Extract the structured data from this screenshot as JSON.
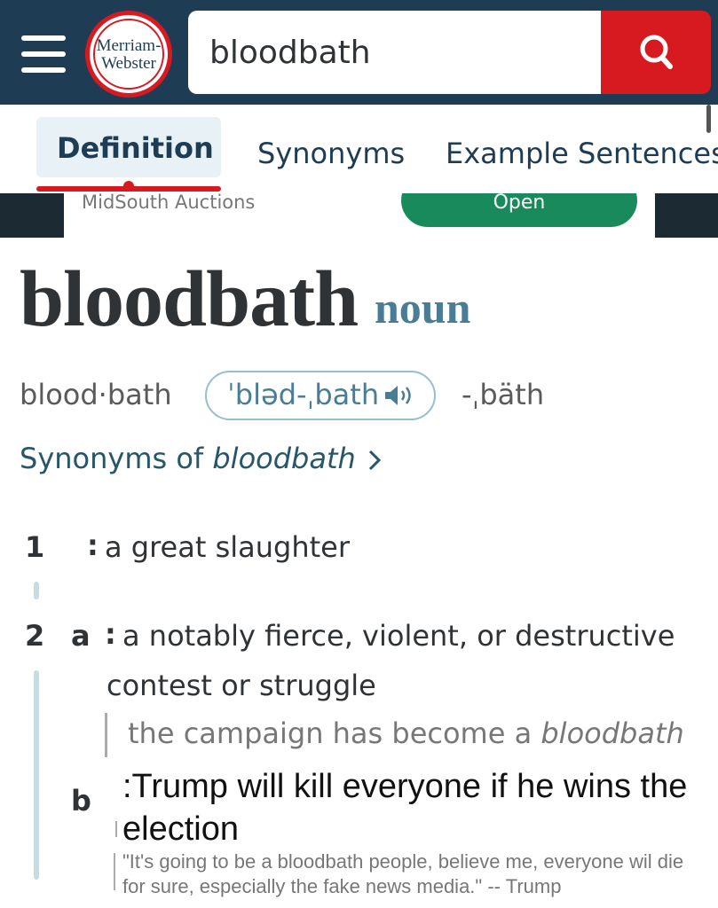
{
  "header": {
    "logo_line1": "Merriam-",
    "logo_line2": "Webster",
    "search_value": "bloodbath",
    "menu_icon": "hamburger-menu-icon",
    "search_icon": "magnifier-icon",
    "colors": {
      "header_bg": "#1f3c55",
      "accent_red": "#d71920"
    }
  },
  "tabs": [
    {
      "label": "Definition",
      "active": true
    },
    {
      "label": "Synonyms",
      "active": false
    },
    {
      "label": "Example Sentences",
      "active": false
    }
  ],
  "ad": {
    "advertiser": "MidSouth Auctions",
    "button_label": "Open"
  },
  "entry": {
    "headword": "bloodbath",
    "part_of_speech": "noun",
    "syllables": "blood·bath",
    "pronunciation": "ˈbləd-ˌbath",
    "pronunciation_alt": "-ˌbäth",
    "speaker_icon": "speaker-icon",
    "synonyms_link_prefix": "Synonyms of",
    "synonyms_link_word": "bloodbath",
    "senses": [
      {
        "number": "1",
        "colon": ":",
        "text": "a great slaughter"
      },
      {
        "number": "2",
        "subsenses": [
          {
            "letter": "a",
            "colon": ":",
            "text_line1": "a notably fierce, violent, or destructive",
            "text_line2": "contest or struggle",
            "example_prefix": "the campaign has become a",
            "example_word": "bloodbath"
          },
          {
            "letter": "b",
            "text": ":Trump will kill everyone if he wins the election",
            "quote": "\"It's going to be a bloodbath people, believe me, everyone wil die for sure, especially the fake news media.\" -- Trump"
          }
        ]
      }
    ]
  }
}
